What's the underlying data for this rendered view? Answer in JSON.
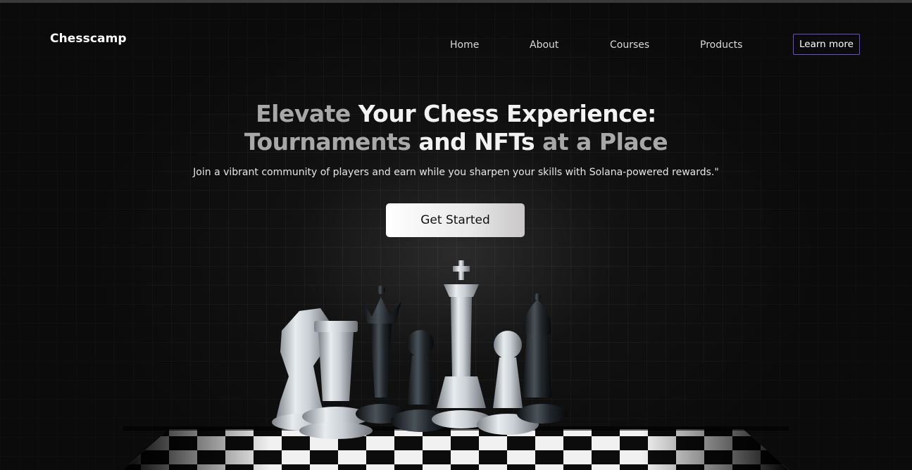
{
  "brand": {
    "logo": "Chesscamp"
  },
  "nav": {
    "items": [
      "Home",
      "About",
      "Courses",
      "Products"
    ],
    "cta_label": "Learn more",
    "cta_border_color": "#6c4bd6"
  },
  "hero": {
    "headline_line1": {
      "part1": "Elevate ",
      "part2": "Your Chess Experience:"
    },
    "headline_line2": {
      "part1": "Tournaments",
      "part2": " and NFTs ",
      "part3": "at a Place"
    },
    "subtitle": "Join a vibrant community of players and earn while you sharpen your skills with Solana-powered rewards.\"",
    "cta_label": "Get Started",
    "image": "chess-pieces-on-board"
  },
  "colors": {
    "background": "#0b0b0b",
    "text_primary": "#f2f2f2",
    "text_dim": "#a8a8a8",
    "accent": "#6c4bd6"
  }
}
